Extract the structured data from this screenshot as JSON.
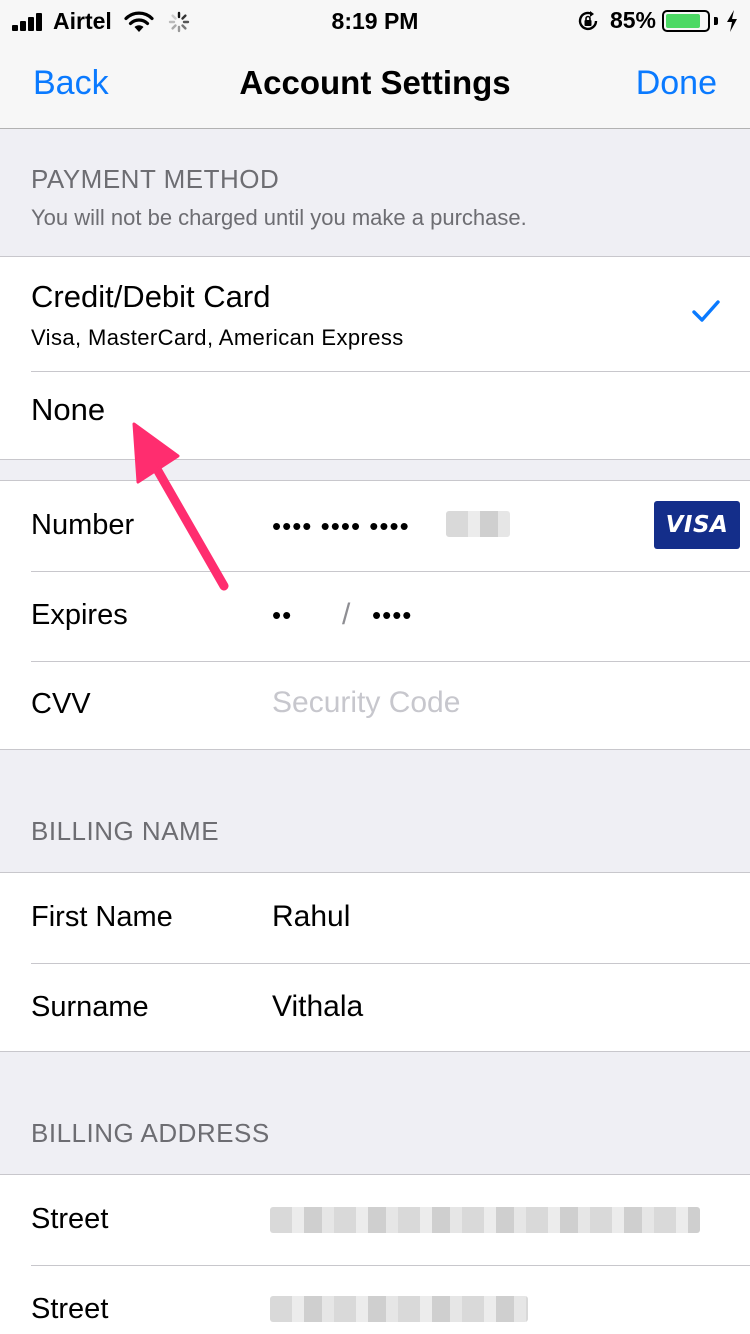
{
  "status_bar": {
    "carrier": "Airtel",
    "time": "8:19 PM",
    "battery_percent": "85%",
    "battery_level": 0.85,
    "icons": [
      "signal-icon",
      "wifi-icon",
      "loading-spinner-icon",
      "rotation-lock-icon",
      "battery-icon",
      "charging-bolt-icon"
    ]
  },
  "nav": {
    "back_label": "Back",
    "title": "Account Settings",
    "done_label": "Done",
    "accent_color": "#0a7aff"
  },
  "payment": {
    "header": "PAYMENT METHOD",
    "subheader": "You will not be charged until you make a purchase.",
    "options": [
      {
        "title": "Credit/Debit Card",
        "subtitle": "Visa, MasterCard, American Express",
        "selected": true
      },
      {
        "title": "None",
        "selected": false
      }
    ]
  },
  "card": {
    "number_label": "Number",
    "number_value": "•••• •••• ••••",
    "brand_label": "VISA",
    "brand_color": "#142e8a",
    "expires_label": "Expires",
    "expires_month": "••",
    "expires_separator": "/",
    "expires_year": "••••",
    "cvv_label": "CVV",
    "cvv_placeholder": "Security Code"
  },
  "billing_name": {
    "header": "BILLING NAME",
    "first_name_label": "First Name",
    "first_name_value": "Rahul",
    "surname_label": "Surname",
    "surname_value": "Vithala"
  },
  "billing_address": {
    "header": "BILLING ADDRESS",
    "street_label_1": "Street",
    "street_label_2": "Street"
  },
  "annotation": {
    "arrow_color": "#ff2d6f"
  }
}
